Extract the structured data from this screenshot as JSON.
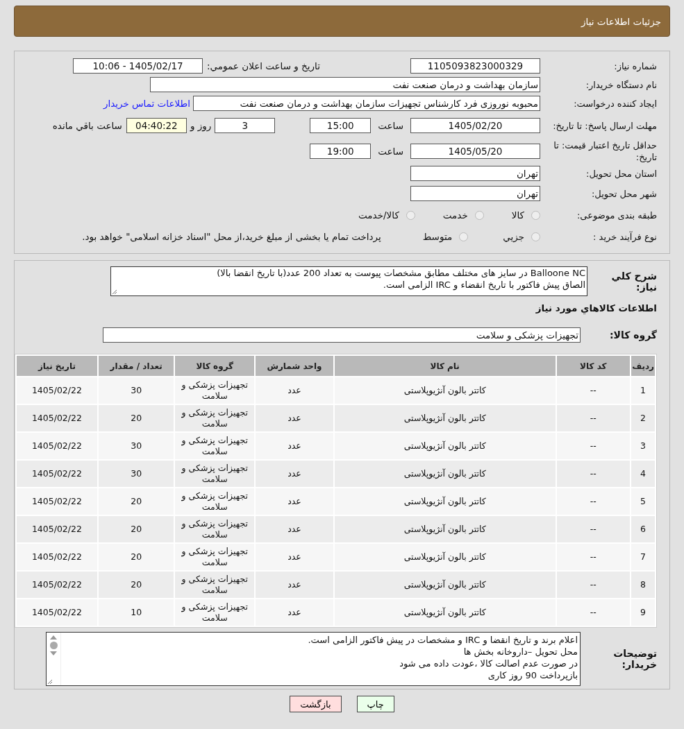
{
  "header": {
    "title": "جزئیات اطلاعات نیاز"
  },
  "details": {
    "need_number": {
      "label": "شماره نیاز:",
      "value": "1105093823000329"
    },
    "announce": {
      "label": "تاریخ و ساعت اعلان عمومي:",
      "value": "1405/02/17 - 10:06"
    },
    "buyer_org": {
      "label": "نام دستگاه خریدار:",
      "value": "سازمان بهداشت و درمان صنعت نفت"
    },
    "requester": {
      "label": "ایجاد کننده درخواست:",
      "value": "محبوبه نوروزی فرد کارشناس تجهیزات سازمان بهداشت و درمان صنعت نفت",
      "link": "اطلاعات تماس خریدار"
    },
    "response_deadline": {
      "label": "مهلت ارسال پاسخ: تا تاریخ:",
      "date": "1405/02/20",
      "time_label": "ساعت",
      "time": "15:00",
      "days": "3",
      "days_label": "روز و",
      "remaining": "04:40:22",
      "remaining_label": "ساعت باقي مانده"
    },
    "price_validity": {
      "label": "حداقل تاریخ اعتبار قیمت: تا تاریخ:",
      "date": "1405/05/20",
      "time_label": "ساعت",
      "time": "19:00"
    },
    "province": {
      "label": "استان محل تحویل:",
      "value": "تهران"
    },
    "city": {
      "label": "شهر محل تحویل:",
      "value": "تهران"
    },
    "category": {
      "label": "طبقه بندی موضوعی:",
      "options": [
        {
          "label": "کالا",
          "selected": false
        },
        {
          "label": "خدمت",
          "selected": false
        },
        {
          "label": "کالا/خدمت",
          "selected": false
        }
      ]
    },
    "purchase_process": {
      "label": "نوع فرآیند خرید :",
      "options": [
        {
          "label": "جزیي",
          "selected": false
        },
        {
          "label": "متوسط",
          "selected": false
        }
      ],
      "note": "پرداخت تمام یا بخشی از مبلغ خرید،از محل \"اسناد خزانه اسلامی\" خواهد بود."
    }
  },
  "description": {
    "label": "شرح کلي نیاز:",
    "lines": [
      "Balloone NC در سایز های مختلف مطابق مشخصات پیوست به تعداد 200 عدد(با تاریخ انقضا بالا)",
      "الصاق پیش فاکتور با تاریخ انقضاء و IRC الزامی است."
    ]
  },
  "goods_title": "اطلاعات کالاهاي مورد نیاز",
  "goods_group": {
    "label": "گروه کالا:",
    "value": "تجهیزات پزشکی و سلامت"
  },
  "table": {
    "columns": [
      "ردیف",
      "کد کالا",
      "نام کالا",
      "واحد شمارش",
      "گروه کالا",
      "تعداد / مقدار",
      "تاریخ نیاز"
    ],
    "rows": [
      [
        "1",
        "--",
        "کاتتر بالون آنژیوپلاستی",
        "عدد",
        "تجهیزات پزشکی و سلامت",
        "30",
        "1405/02/22"
      ],
      [
        "2",
        "--",
        "کاتتر بالون آنژیوپلاستی",
        "عدد",
        "تجهیزات پزشکی و سلامت",
        "20",
        "1405/02/22"
      ],
      [
        "3",
        "--",
        "کاتتر بالون آنژیوپلاستی",
        "عدد",
        "تجهیزات پزشکی و سلامت",
        "30",
        "1405/02/22"
      ],
      [
        "4",
        "--",
        "کاتتر بالون آنژیوپلاستی",
        "عدد",
        "تجهیزات پزشکی و سلامت",
        "30",
        "1405/02/22"
      ],
      [
        "5",
        "--",
        "کاتتر بالون آنژیوپلاستی",
        "عدد",
        "تجهیزات پزشکی و سلامت",
        "20",
        "1405/02/22"
      ],
      [
        "6",
        "--",
        "کاتتر بالون آنژیوپلاستی",
        "عدد",
        "تجهیزات پزشکی و سلامت",
        "20",
        "1405/02/22"
      ],
      [
        "7",
        "--",
        "کاتتر بالون آنژیوپلاستی",
        "عدد",
        "تجهیزات پزشکی و سلامت",
        "20",
        "1405/02/22"
      ],
      [
        "8",
        "--",
        "کاتتر بالون آنژیوپلاستی",
        "عدد",
        "تجهیزات پزشکی و سلامت",
        "20",
        "1405/02/22"
      ],
      [
        "9",
        "--",
        "کاتتر بالون آنژیوپلاستی",
        "عدد",
        "تجهیزات پزشکی و سلامت",
        "10",
        "1405/02/22"
      ]
    ]
  },
  "buyer_notes": {
    "label": "توضیحات خریدار:",
    "lines": [
      "اعلام برند و تاریخ انقضا  و IRC  و مشخصات در پیش فاکتور الزامی است.",
      "محل تحویل –داروخانه بخش ها",
      "در صورت عدم اصالت کالا ،عودت داده می شود",
      "بازپرداخت 90 روز کاری"
    ]
  },
  "buttons": [
    {
      "label": "چاپ",
      "kind": "print"
    },
    {
      "label": "بازگشت",
      "kind": "back"
    }
  ]
}
